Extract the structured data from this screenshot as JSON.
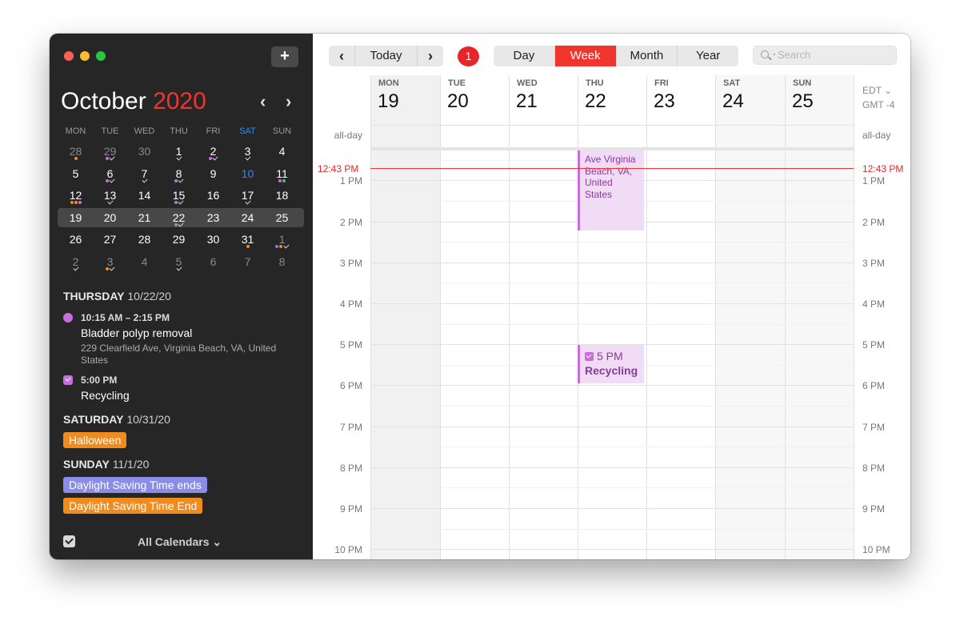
{
  "sidebar": {
    "add_label": "+",
    "month": "October",
    "year": "2020",
    "prev_label": "‹",
    "next_label": "›",
    "weekdays": [
      "MON",
      "TUE",
      "WED",
      "THU",
      "FRI",
      "SAT",
      "SUN"
    ],
    "weeks": [
      [
        "28",
        "29",
        "30",
        "1",
        "2",
        "3",
        "4"
      ],
      [
        "5",
        "6",
        "7",
        "8",
        "9",
        "10",
        "11"
      ],
      [
        "12",
        "13",
        "14",
        "15",
        "16",
        "17",
        "18"
      ],
      [
        "19",
        "20",
        "21",
        "22",
        "23",
        "24",
        "25"
      ],
      [
        "26",
        "27",
        "28",
        "29",
        "30",
        "31",
        "1"
      ],
      [
        "2",
        "3",
        "4",
        "5",
        "6",
        "7",
        "8"
      ]
    ],
    "agenda": {
      "thursday": {
        "day": "THURSDAY",
        "date": "10/22/20"
      },
      "event1": {
        "time": "10:15 AM – 2:15 PM",
        "title": "Bladder polyp removal",
        "location": "229 Clearfield Ave, Virginia Beach, VA, United States"
      },
      "event2": {
        "time": "5:00 PM",
        "title": "Recycling"
      },
      "saturday": {
        "day": "SATURDAY",
        "date": "10/31/20"
      },
      "halloween": "Halloween",
      "sunday": {
        "day": "SUNDAY",
        "date": "11/1/20"
      },
      "dst1": "Daylight Saving Time ends",
      "dst2": "Daylight Saving Time End"
    },
    "footer_label": "All Calendars ⌄"
  },
  "toolbar": {
    "prev": "‹",
    "today": "Today",
    "next": "›",
    "badge": "1",
    "views": [
      "Day",
      "Week",
      "Month",
      "Year"
    ],
    "active_view": "Week",
    "search_placeholder": "Search"
  },
  "week": {
    "days": [
      {
        "name": "MON",
        "num": "19"
      },
      {
        "name": "TUE",
        "num": "20"
      },
      {
        "name": "WED",
        "num": "21"
      },
      {
        "name": "THU",
        "num": "22"
      },
      {
        "name": "FRI",
        "num": "23"
      },
      {
        "name": "SAT",
        "num": "24"
      },
      {
        "name": "SUN",
        "num": "25"
      }
    ],
    "allday_label": "all-day",
    "tz_line1": "EDT ⌄",
    "tz_line2": "GMT -4",
    "now_label": "12:43 PM",
    "hours": [
      "1 PM",
      "2 PM",
      "3 PM",
      "4 PM",
      "5 PM",
      "6 PM",
      "7 PM",
      "8 PM",
      "9 PM",
      "10 PM"
    ],
    "event1_text": "Ave Virginia Beach, VA, United States",
    "event2_time": "5 PM",
    "event2_title": "Recycling"
  },
  "colors": {
    "accent": "#f0352e",
    "event_purple": "#c66fdb",
    "event_orange": "#f08b1e",
    "event_blue": "#8b8ce8"
  }
}
